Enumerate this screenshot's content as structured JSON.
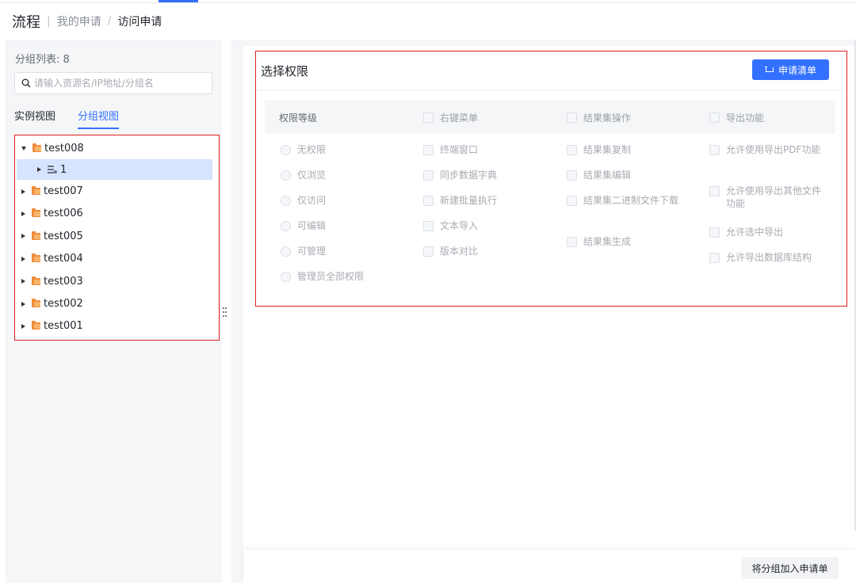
{
  "breadcrumb": {
    "root": "流程",
    "mid": "我的申请",
    "separator": "/",
    "current": "访问申请"
  },
  "sidebar": {
    "count_label": "分组列表: 8",
    "search_placeholder": "请输入资源名/IP地址/分组名",
    "tabs": [
      {
        "label": "实例视图",
        "active": false
      },
      {
        "label": "分组视图",
        "active": true
      }
    ],
    "tree": [
      {
        "label": "test008",
        "expanded": true,
        "children": [
          {
            "label": "1"
          }
        ]
      },
      {
        "label": "test007",
        "expanded": false
      },
      {
        "label": "test006",
        "expanded": false
      },
      {
        "label": "test005",
        "expanded": false
      },
      {
        "label": "test004",
        "expanded": false
      },
      {
        "label": "test003",
        "expanded": false
      },
      {
        "label": "test002",
        "expanded": false
      },
      {
        "label": "test001",
        "expanded": false
      }
    ]
  },
  "permissions": {
    "title": "选择权限",
    "apply_button": "申请清单",
    "header": {
      "level": "权限等级",
      "right_menu": "右键菜单",
      "result_ops": "结果集操作",
      "export": "导出功能"
    },
    "levels": [
      "无权限",
      "仅浏览",
      "仅访问",
      "可编辑",
      "可管理",
      "管理员全部权限"
    ],
    "right_menu_items": [
      "终端窗口",
      "同步数据字典",
      "新建批量执行",
      "文本导入",
      "版本对比"
    ],
    "result_items": [
      "结果集复制",
      "结果集编辑",
      "结果集二进制文件下载",
      "结果集生成"
    ],
    "export_items": [
      "允许使用导出PDF功能",
      "允许使用导出其他文件功能",
      "允许选中导出",
      "允许导出数据库结构"
    ]
  },
  "footer": {
    "add_button": "将分组加入申请单"
  },
  "colors": {
    "accent": "#3370ff",
    "highlight_border": "#e02020",
    "selected_row": "#d6e4ff"
  }
}
